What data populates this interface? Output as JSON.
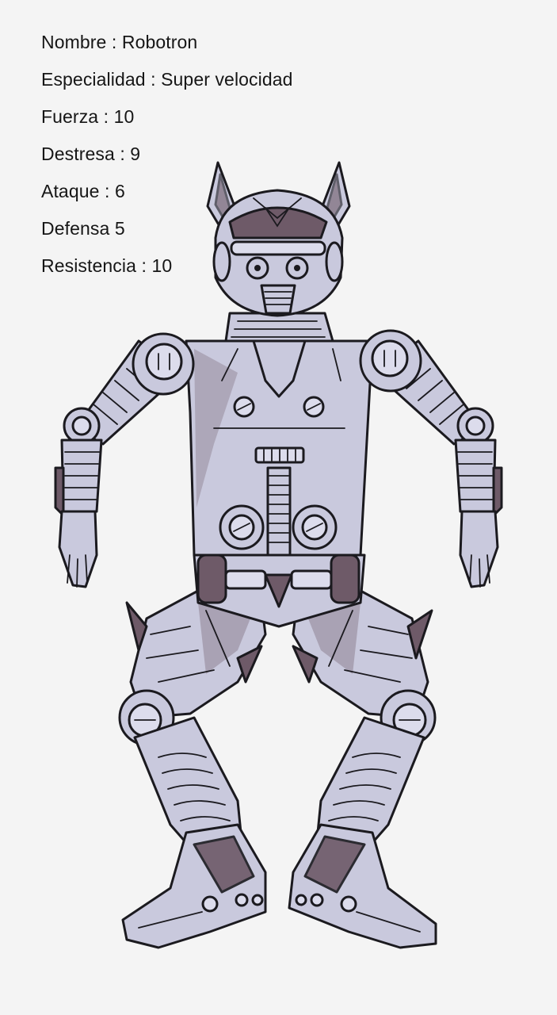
{
  "character": {
    "stats": [
      {
        "key": "nombre",
        "text": "Nombre : Robotron"
      },
      {
        "key": "especialidad",
        "text": "Especialidad : Super velocidad"
      },
      {
        "key": "fuerza",
        "text": "Fuerza : 10"
      },
      {
        "key": "destresa",
        "text": "Destresa : 9"
      },
      {
        "key": "ataque",
        "text": "Ataque : 6"
      },
      {
        "key": "defensa",
        "text": "Defensa 5"
      },
      {
        "key": "resistencia",
        "text": "Resistencia : 10"
      }
    ]
  },
  "colors": {
    "background": "#f4f4f4",
    "robot_body": "#c9c9dd",
    "robot_shadow": "#6e5a68",
    "outline": "#1b1a1f"
  }
}
